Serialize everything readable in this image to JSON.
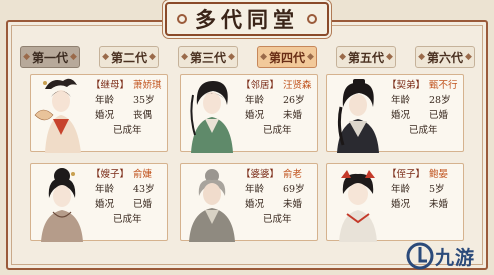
{
  "title": "多代同堂",
  "tabs": [
    {
      "label": "第一代",
      "style": "dark"
    },
    {
      "label": "第二代",
      "style": "light"
    },
    {
      "label": "第三代",
      "style": "light"
    },
    {
      "label": "第四代",
      "style": "active"
    },
    {
      "label": "第五代",
      "style": "light"
    },
    {
      "label": "第六代",
      "style": "light"
    }
  ],
  "labels": {
    "age": "年龄",
    "marital": "婚况"
  },
  "members": [
    {
      "role": "【继母】",
      "name": "萧娇琪",
      "age": "35岁",
      "marital": "丧偶",
      "status": "已成年",
      "portrait": "woman-fan-portrait"
    },
    {
      "role": "【邻居】",
      "name": "汪贤森",
      "age": "26岁",
      "marital": "未婚",
      "status": "已成年",
      "portrait": "young-man-portrait"
    },
    {
      "role": "【契弟】",
      "name": "甄不行",
      "age": "28岁",
      "marital": "已婚",
      "status": "已成年",
      "portrait": "scholar-man-portrait"
    },
    {
      "role": "【嫂子】",
      "name": "俞婕",
      "age": "43岁",
      "marital": "已婚",
      "status": "已成年",
      "portrait": "lady-portrait"
    },
    {
      "role": "【婆婆】",
      "name": "俞老",
      "age": "69岁",
      "marital": "未婚",
      "status": "已成年",
      "portrait": "old-woman-portrait"
    },
    {
      "role": "【侄子】",
      "name": "鲍晏",
      "age": "5岁",
      "marital": "未婚",
      "status": "",
      "portrait": "child-portrait"
    }
  ],
  "watermark": "九游",
  "colors": {
    "frame": "#9a5a3a",
    "active_tab": "#f2c99a",
    "name": "#c0521c"
  }
}
